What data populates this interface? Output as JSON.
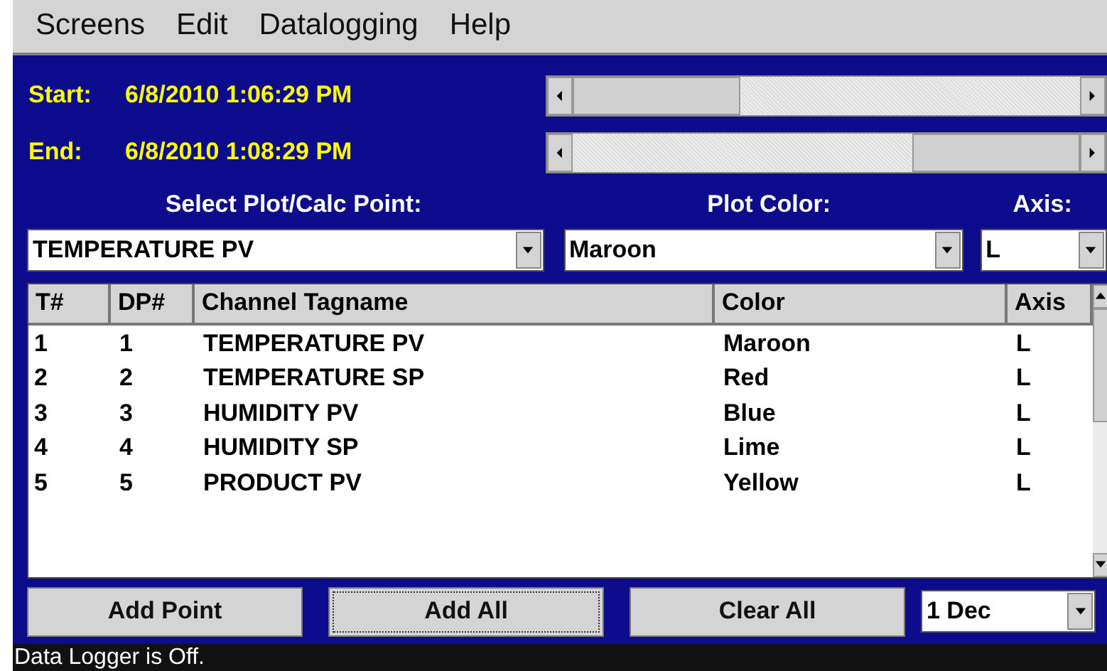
{
  "menu": [
    "Screens",
    "Edit",
    "Datalogging",
    "Help"
  ],
  "range": [
    {
      "label": "Start:",
      "value": "6/8/2010 1:06:29 PM",
      "level": 0
    },
    {
      "label": "End:",
      "value": "6/8/2010 1:08:29 PM",
      "level": 1
    }
  ],
  "selectors": [
    {
      "label": "Select Plot/Calc Point:",
      "value": "TEMPERATURE PV"
    },
    {
      "label": "Plot Color:",
      "value": "Maroon"
    },
    {
      "label": "Axis:",
      "value": "L"
    }
  ],
  "table": {
    "columns": [
      "T#",
      "DP#",
      "Channel Tagname",
      "Color",
      "Axis"
    ],
    "rows": [
      [
        "1",
        "1",
        "TEMPERATURE PV",
        "Maroon",
        "L"
      ],
      [
        "2",
        "2",
        "TEMPERATURE SP",
        "Red",
        "L"
      ],
      [
        "3",
        "3",
        "HUMIDITY PV",
        "Blue",
        "L"
      ],
      [
        "4",
        "4",
        "HUMIDITY SP",
        "Lime",
        "L"
      ],
      [
        "5",
        "5",
        "PRODUCT PV",
        "Yellow",
        "L"
      ]
    ]
  },
  "buttons": [
    {
      "label": "Add Point",
      "focused": false
    },
    {
      "label": "Add All",
      "focused": true
    },
    {
      "label": "Clear All",
      "focused": false
    }
  ],
  "decimals": {
    "value": "1 Dec"
  },
  "status_bar": "Data Logger is Off."
}
